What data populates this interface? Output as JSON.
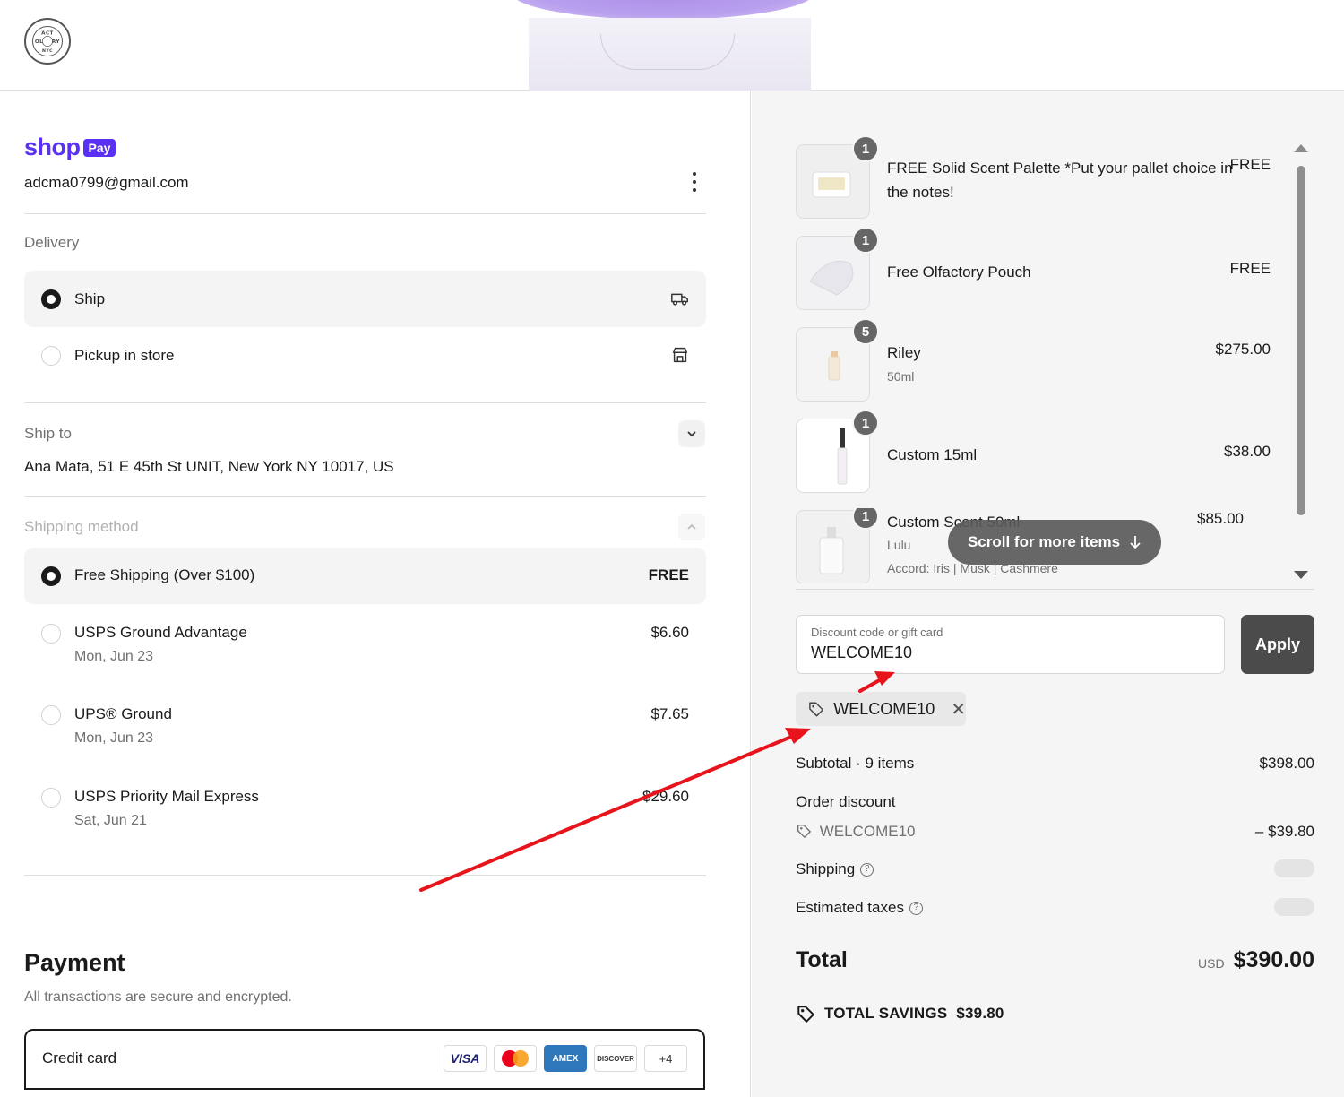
{
  "header": {
    "logo_text": "OLFACTORY NYC"
  },
  "left": {
    "shop_pay": {
      "word": "shop",
      "pill": "Pay"
    },
    "email": "adcma0799@gmail.com",
    "delivery": {
      "label": "Delivery",
      "options": [
        {
          "label": "Ship",
          "selected": true,
          "icon": "truck-icon"
        },
        {
          "label": "Pickup in store",
          "selected": false,
          "icon": "store-icon"
        }
      ]
    },
    "ship_to": {
      "label": "Ship to",
      "address": "Ana Mata, 51 E 45th St UNIT, New York NY 10017, US"
    },
    "shipping_method": {
      "label": "Shipping method",
      "options": [
        {
          "label": "Free Shipping (Over $100)",
          "sub": "",
          "price": "FREE",
          "selected": true
        },
        {
          "label": "USPS Ground Advantage",
          "sub": "Mon, Jun 23",
          "price": "$6.60",
          "selected": false
        },
        {
          "label": "UPS® Ground",
          "sub": "Mon, Jun 23",
          "price": "$7.65",
          "selected": false
        },
        {
          "label": "USPS Priority Mail Express",
          "sub": "Sat, Jun 21",
          "price": "$29.60",
          "selected": false
        }
      ]
    },
    "payment": {
      "title": "Payment",
      "subtitle": "All transactions are secure and encrypted.",
      "method_label": "Credit card",
      "cards": [
        "VISA",
        "mastercard",
        "AMEX",
        "DISCOVER",
        "+4"
      ]
    }
  },
  "right": {
    "items": [
      {
        "qty": "1",
        "name": "FREE Solid Scent Palette *Put your pallet choice in the notes!",
        "sub": "",
        "sub2": "",
        "price": "FREE"
      },
      {
        "qty": "1",
        "name": "Free Olfactory Pouch",
        "sub": "",
        "sub2": "",
        "price": "FREE"
      },
      {
        "qty": "5",
        "name": "Riley",
        "sub": "50ml",
        "sub2": "",
        "price": "$275.00"
      },
      {
        "qty": "1",
        "name": "Custom 15ml",
        "sub": "",
        "sub2": "",
        "price": "$38.00"
      },
      {
        "qty": "1",
        "name": "Custom Scent 50ml",
        "sub": "Lulu",
        "sub2": "Accord: Iris | Musk | Cashmere",
        "price": "$85.00"
      }
    ],
    "scroll_hint": "Scroll for more items",
    "discount": {
      "placeholder": "Discount code or gift card",
      "value": "WELCOME10",
      "apply_label": "Apply",
      "applied_code": "WELCOME10"
    },
    "summary": {
      "subtotal_label": "Subtotal · 9 items",
      "subtotal_value": "$398.00",
      "order_discount_label": "Order discount",
      "discount_code": "WELCOME10",
      "discount_value": "– $39.80",
      "shipping_label": "Shipping",
      "taxes_label": "Estimated taxes",
      "total_label": "Total",
      "currency": "USD",
      "total_value": "$390.00",
      "savings_label": "TOTAL SAVINGS",
      "savings_value": "$39.80"
    }
  },
  "annotation_color": "#e8141c"
}
